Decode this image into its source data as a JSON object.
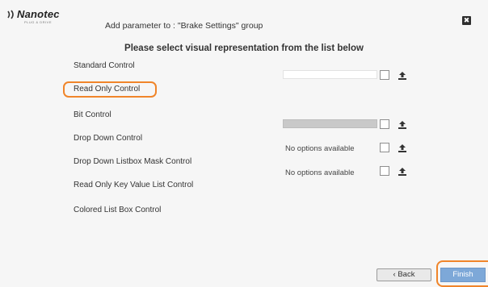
{
  "header": {
    "brand": "Nanotec",
    "brand_tagline": "PLUG & DRIVE",
    "title": "Add parameter to : \"Brake Settings\" group",
    "close_glyph": "✖"
  },
  "heading": "Please select visual representation from the list below",
  "options": [
    {
      "label": "Standard Control"
    },
    {
      "label": "Read Only Control",
      "selected": true
    },
    {
      "label": "Bit Control"
    },
    {
      "label": "Drop Down Control"
    },
    {
      "label": "Drop Down Listbox Mask Control"
    },
    {
      "label": "Read Only Key Value List Control"
    },
    {
      "label": "Colored List Box Control"
    }
  ],
  "previews": {
    "no_options_1": "No options available",
    "no_options_2": "No options available"
  },
  "buttons": {
    "back": "‹  Back",
    "finish": "Finish"
  },
  "colors": {
    "highlight": "#f0852a",
    "finish_bg": "#7da8d8",
    "background": "#f6f6f6"
  },
  "icons": [
    "upload-icon",
    "close-icon",
    "nanotec-logo"
  ]
}
